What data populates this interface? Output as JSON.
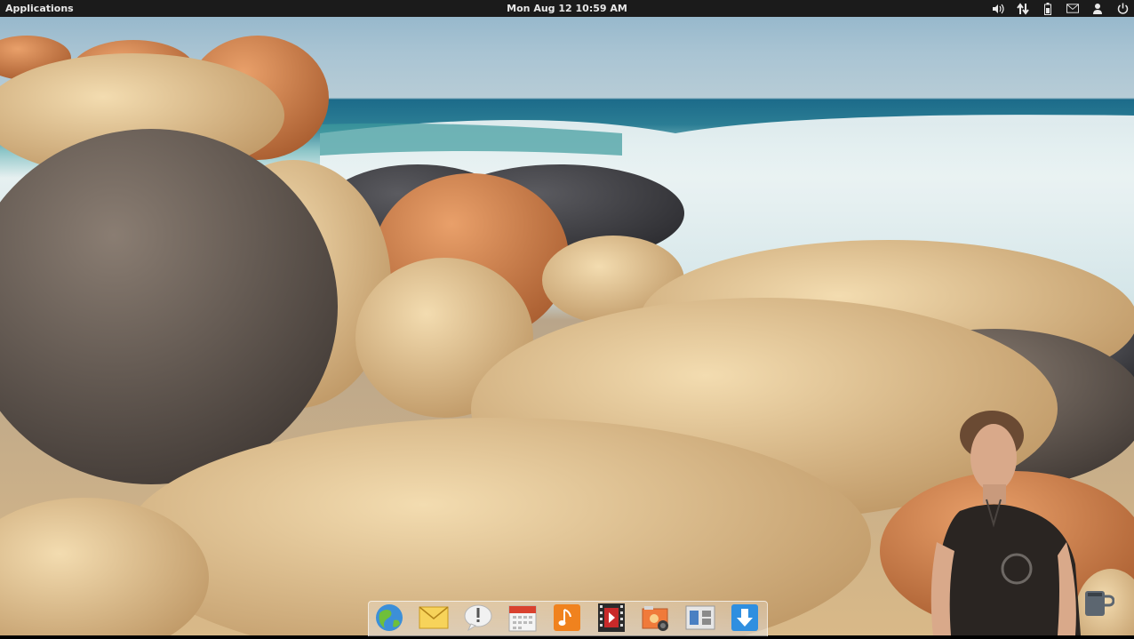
{
  "panel": {
    "applications_label": "Applications",
    "clock": "Mon Aug 12 10:59 AM",
    "indicators": [
      "volume-icon",
      "network-icon",
      "battery-icon",
      "mail-icon",
      "user-icon",
      "power-icon"
    ]
  },
  "dock": {
    "items": [
      {
        "name": "web-browser",
        "icon": "globe-icon"
      },
      {
        "name": "mail",
        "icon": "envelope-icon"
      },
      {
        "name": "notifications",
        "icon": "exclamation-bubble-icon"
      },
      {
        "name": "calendar",
        "icon": "calendar-icon"
      },
      {
        "name": "music",
        "icon": "music-note-icon"
      },
      {
        "name": "videos",
        "icon": "film-icon"
      },
      {
        "name": "photos",
        "icon": "photo-icon"
      },
      {
        "name": "system-settings",
        "icon": "switchboard-icon"
      },
      {
        "name": "software-center",
        "icon": "download-arrow-icon"
      }
    ]
  },
  "wallpaper": {
    "subject": "rocks-by-sea"
  },
  "colors": {
    "panel_bg": "#1b1b1b",
    "panel_text": "#e8e8e8",
    "sea": "#2b7d94",
    "rock": "#d9b988"
  }
}
